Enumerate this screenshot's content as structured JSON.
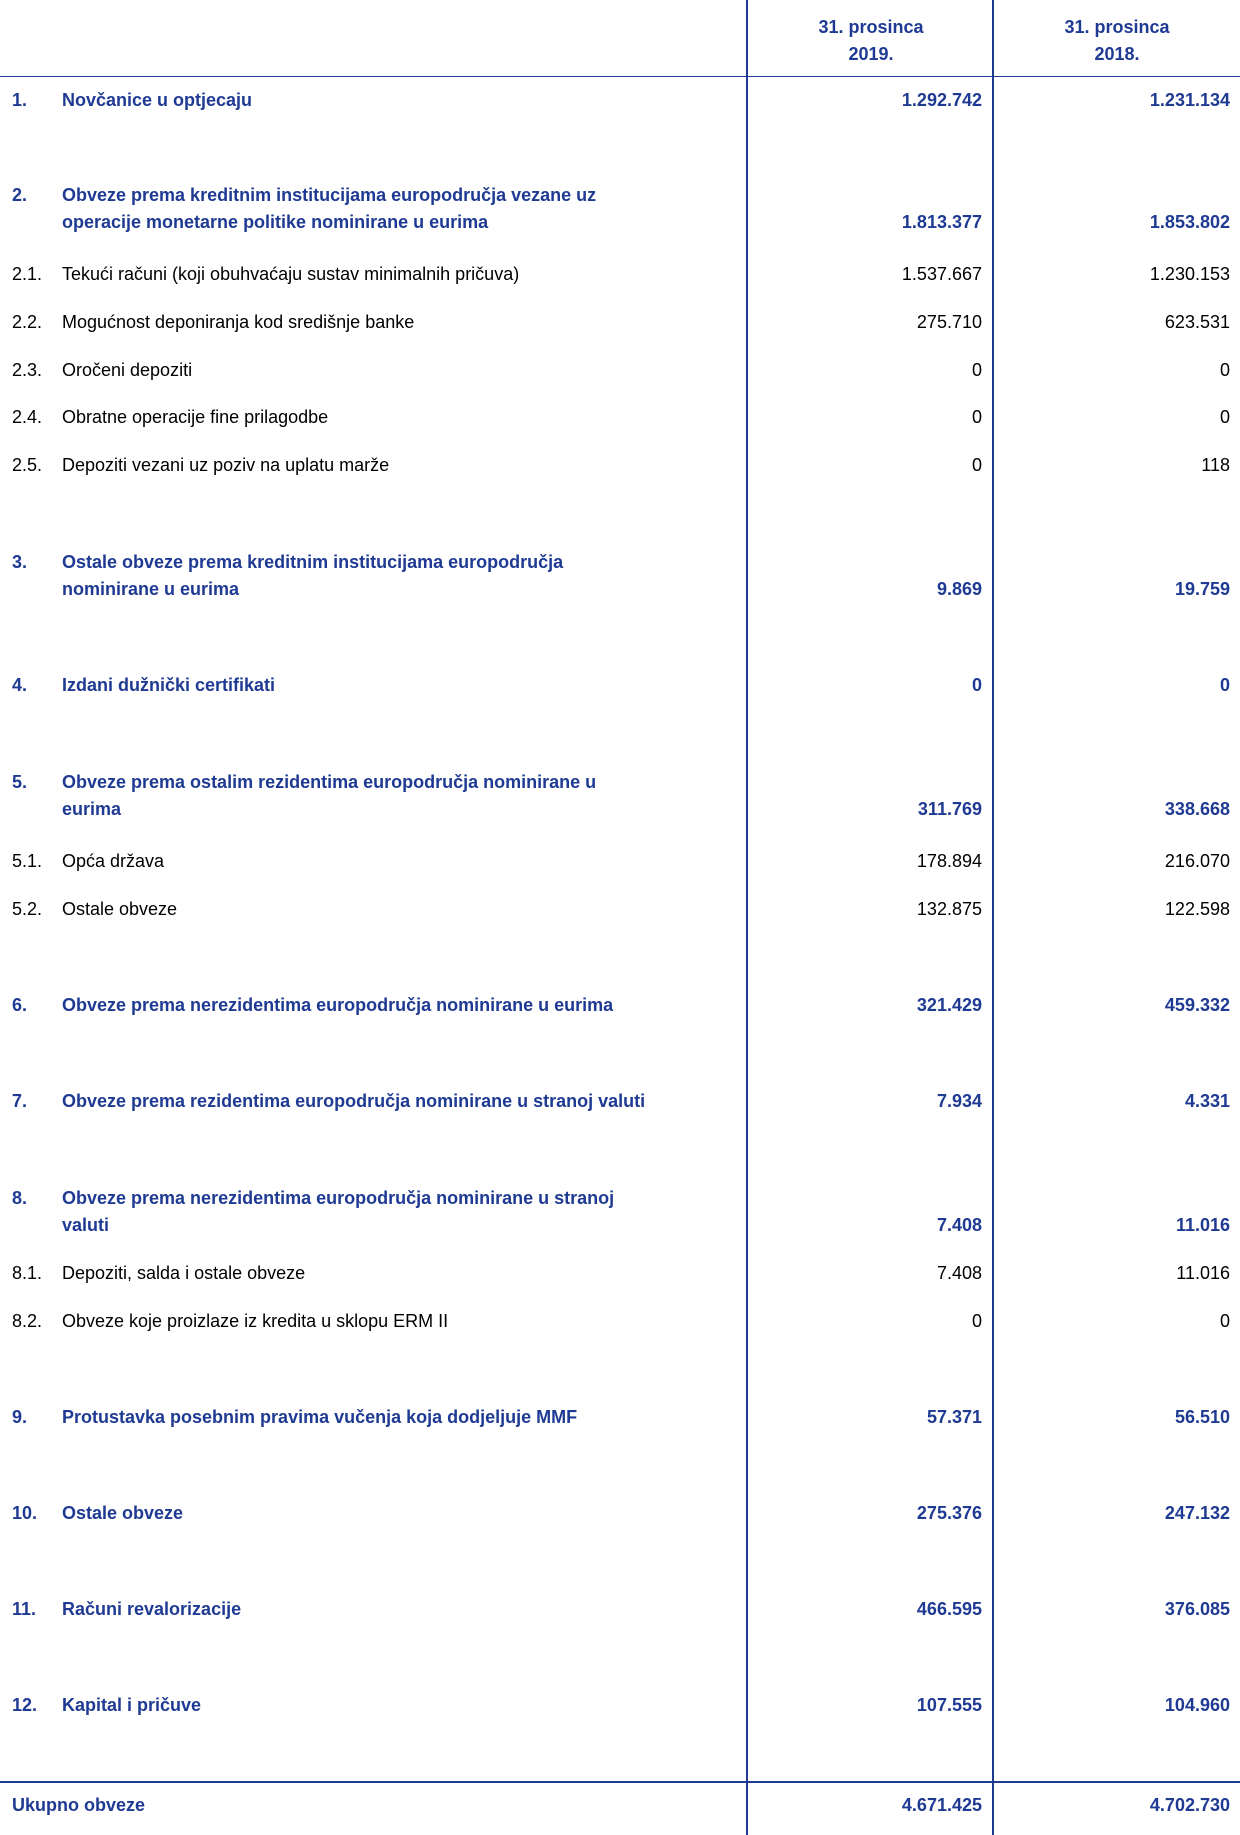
{
  "header": {
    "col1": [
      "31. prosinca",
      "2019."
    ],
    "col2": [
      "31. prosinca",
      "2018."
    ]
  },
  "rows": [
    {
      "num": "1.",
      "label": "Novčanice u optjecaju",
      "v1": "1.292.742",
      "v2": "1.231.134",
      "main": true
    },
    {
      "num": "2.",
      "label": [
        "Obveze prema kreditnim institucijama europodručja vezane uz",
        "operacije monetarne politike nominirane u eurima"
      ],
      "v1": "1.813.377",
      "v2": "1.853.802",
      "main": true
    },
    {
      "num": "2.1.",
      "label": "Tekući računi (koji obuhvaćaju sustav minimalnih pričuva)",
      "v1": "1.537.667",
      "v2": "1.230.153",
      "main": false
    },
    {
      "num": "2.2.",
      "label": "Mogućnost deponiranja kod središnje banke",
      "v1": "275.710",
      "v2": "623.531",
      "main": false
    },
    {
      "num": "2.3.",
      "label": "Oročeni depoziti",
      "v1": "0",
      "v2": "0",
      "main": false
    },
    {
      "num": "2.4.",
      "label": "Obratne operacije fine prilagodbe",
      "v1": "0",
      "v2": "0",
      "main": false
    },
    {
      "num": "2.5.",
      "label": "Depoziti vezani uz poziv na uplatu marže",
      "v1": "0",
      "v2": "118",
      "main": false
    },
    {
      "num": "3.",
      "label": [
        "Ostale obveze prema kreditnim institucijama europodručja",
        "nominirane u eurima"
      ],
      "v1": "9.869",
      "v2": "19.759",
      "main": true
    },
    {
      "num": "4.",
      "label": "Izdani dužnički certifikati",
      "v1": "0",
      "v2": "0",
      "main": true
    },
    {
      "num": "5.",
      "label": [
        "Obveze prema ostalim rezidentima europodručja nominirane u",
        "eurima"
      ],
      "v1": "311.769",
      "v2": "338.668",
      "main": true
    },
    {
      "num": "5.1.",
      "label": "Opća država",
      "v1": "178.894",
      "v2": "216.070",
      "main": false
    },
    {
      "num": "5.2.",
      "label": "Ostale obveze",
      "v1": "132.875",
      "v2": "122.598",
      "main": false
    },
    {
      "num": "6.",
      "label": "Obveze prema nerezidentima europodručja nominirane u eurima",
      "v1": "321.429",
      "v2": "459.332",
      "main": true
    },
    {
      "num": "7.",
      "label": "Obveze prema rezidentima europodručja nominirane u stranoj valuti",
      "v1": "7.934",
      "v2": "4.331",
      "main": true
    },
    {
      "num": "8.",
      "label": [
        "Obveze prema nerezidentima europodručja nominirane u stranoj",
        "valuti"
      ],
      "v1": "7.408",
      "v2": "11.016",
      "main": true
    },
    {
      "num": "8.1.",
      "label": "Depoziti, salda i ostale obveze",
      "v1": "7.408",
      "v2": "11.016",
      "main": false
    },
    {
      "num": "8.2.",
      "label": "Obveze koje proizlaze iz kredita u sklopu ERM II",
      "v1": "0",
      "v2": "0",
      "main": false
    },
    {
      "num": "9.",
      "label": "Protustavka posebnim pravima vučenja koja dodjeljuje MMF",
      "v1": "57.371",
      "v2": "56.510",
      "main": true
    },
    {
      "num": "10.",
      "label": "Ostale obveze",
      "v1": "275.376",
      "v2": "247.132",
      "main": true
    },
    {
      "num": "11.",
      "label": "Računi revalorizacije",
      "v1": "466.595",
      "v2": "376.085",
      "main": true
    },
    {
      "num": "12.",
      "label": "Kapital i pričuve",
      "v1": "107.555",
      "v2": "104.960",
      "main": true
    }
  ],
  "total": {
    "label": "Ukupno obveze",
    "v1": "4.671.425",
    "v2": "4.702.730"
  },
  "colors": {
    "accent": "#1f3a93",
    "text": "#000000"
  }
}
